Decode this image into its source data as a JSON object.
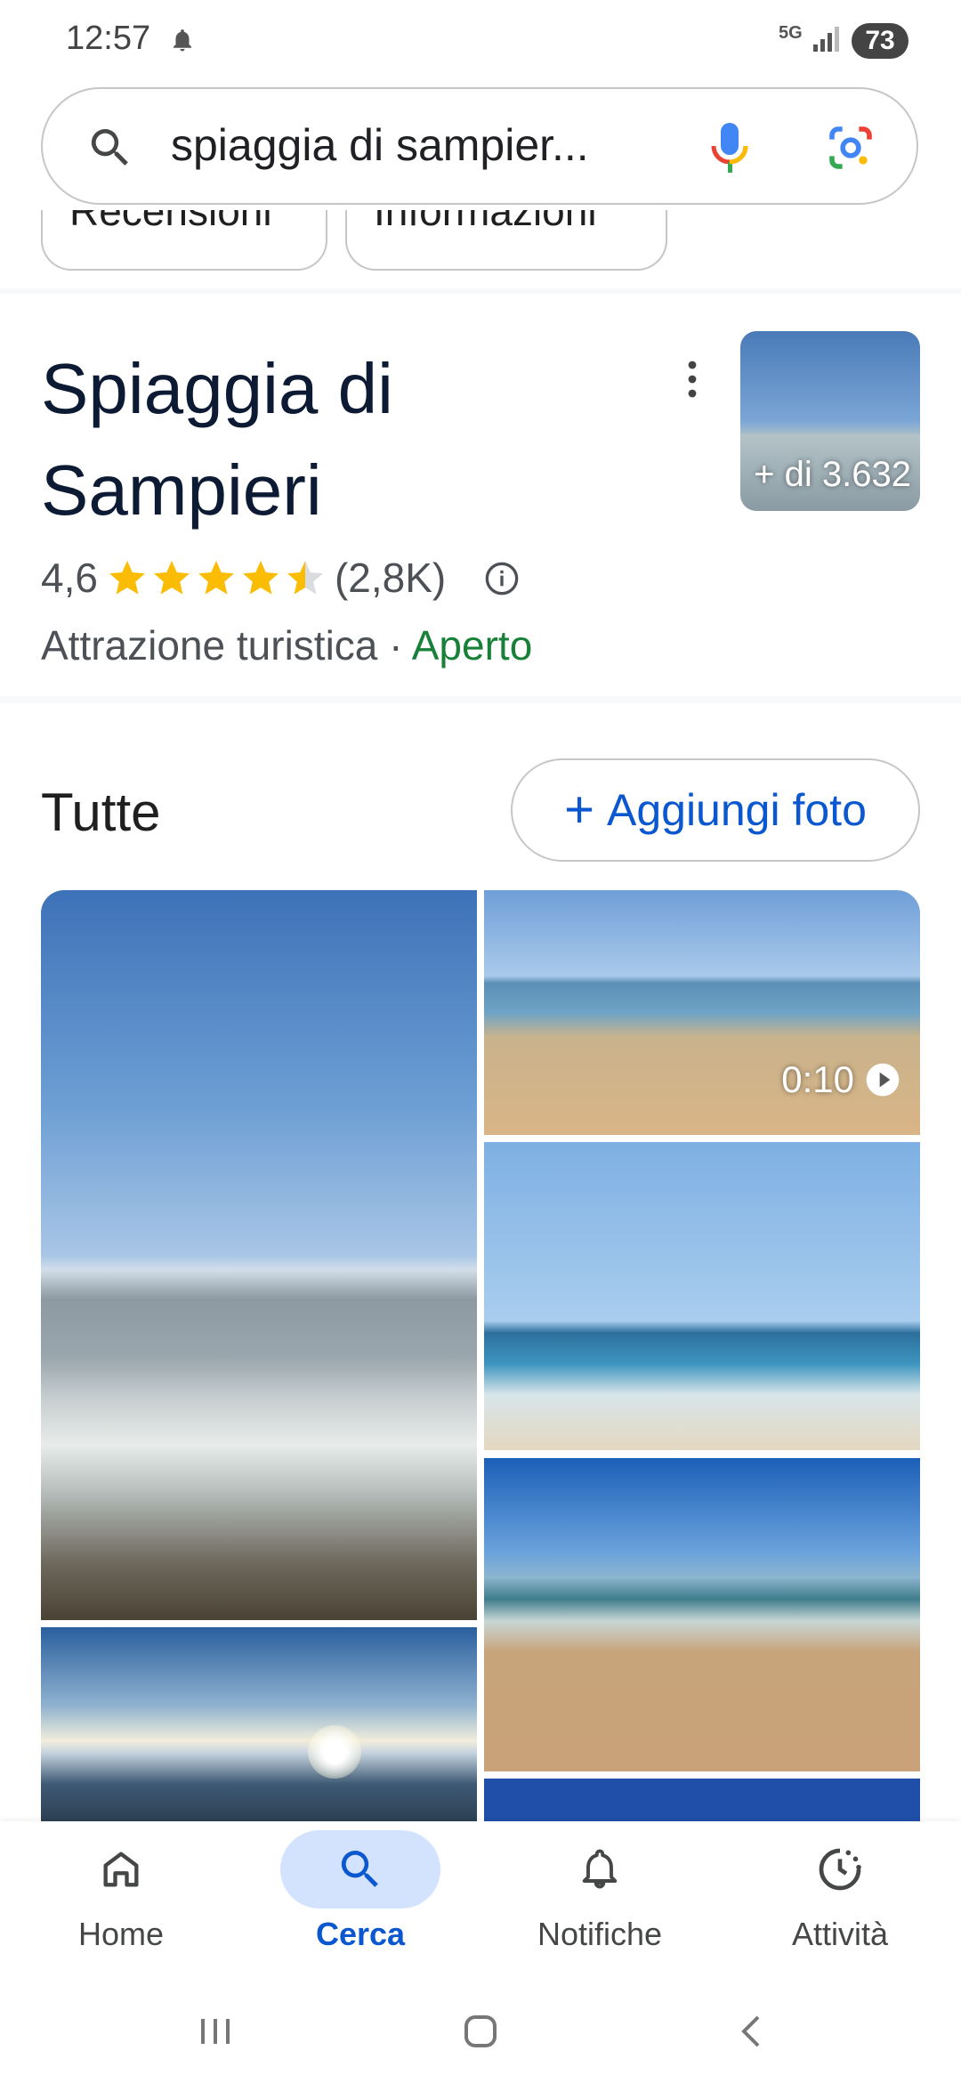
{
  "status": {
    "time": "12:57",
    "network": "5G",
    "battery": "73"
  },
  "search": {
    "query": "spiaggia di sampier..."
  },
  "chips": [
    "Recensioni",
    "Informazioni"
  ],
  "place": {
    "title": "Spiaggia di Sampieri",
    "photo_count": "+ di 3.632",
    "rating": "4,6",
    "stars": 4.5,
    "reviews": "(2,8K)",
    "category": "Attrazione turistica",
    "separator": "·",
    "status": "Aperto"
  },
  "photos": {
    "section_title": "Tutte",
    "add_label": "Aggiungi foto",
    "video_duration": "0:10"
  },
  "bottom_nav": [
    {
      "label": "Home",
      "icon": "home-icon"
    },
    {
      "label": "Cerca",
      "icon": "search-icon"
    },
    {
      "label": "Notifiche",
      "icon": "bell-icon"
    },
    {
      "label": "Attività",
      "icon": "activity-icon"
    }
  ],
  "colors": {
    "accent": "#0b57d0",
    "open": "#188038",
    "star": "#fbbc04"
  }
}
